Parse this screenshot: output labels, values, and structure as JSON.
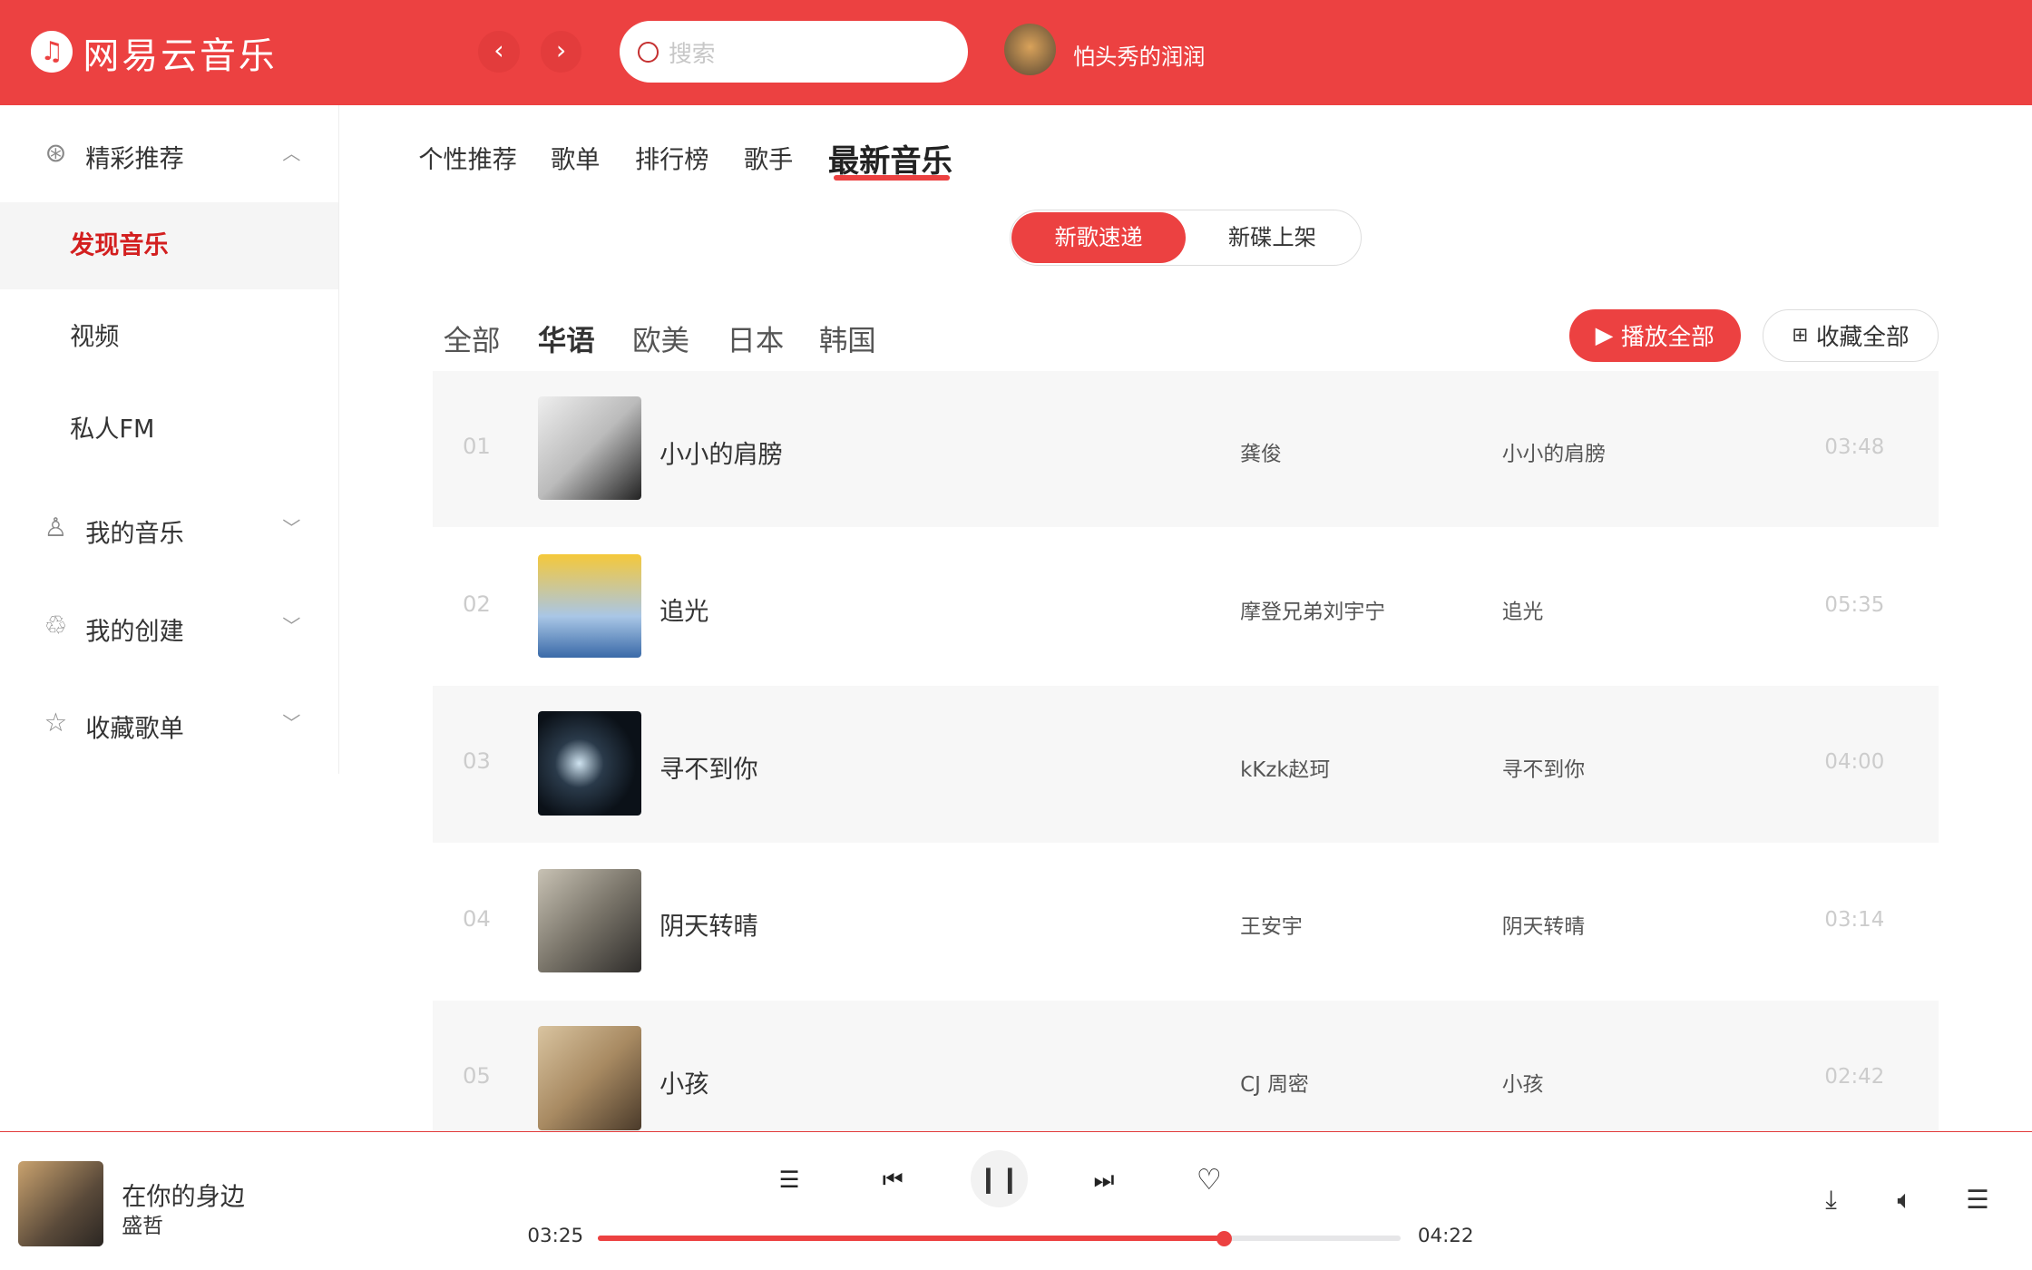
{
  "header": {
    "logo": "网易云音乐",
    "back": "‹",
    "forward": "›",
    "search_placeholder": "搜索",
    "username": "怕头秀的润润"
  },
  "sidebar": {
    "sections": [
      {
        "label": "精彩推荐"
      },
      {
        "label": "我的音乐"
      },
      {
        "label": "我的创建"
      },
      {
        "label": "收藏歌单"
      }
    ],
    "sub_items": [
      {
        "label": "发现音乐",
        "active": true
      },
      {
        "label": "视频"
      },
      {
        "label": "私人FM"
      }
    ]
  },
  "tabs": [
    {
      "label": "个性推荐"
    },
    {
      "label": "歌单"
    },
    {
      "label": "排行榜"
    },
    {
      "label": "歌手"
    },
    {
      "label": "最新音乐",
      "active": true
    }
  ],
  "toggle": {
    "active": "新歌速递",
    "inactive": "新碟上架"
  },
  "filters": [
    {
      "label": "全部"
    },
    {
      "label": "华语",
      "active": true
    },
    {
      "label": "欧美"
    },
    {
      "label": "日本"
    },
    {
      "label": "韩国"
    }
  ],
  "actions": {
    "play_all": "播放全部",
    "collect_all": "收藏全部"
  },
  "songs": [
    {
      "num": "01",
      "title": "小小的肩膀",
      "artist": "龚俊",
      "album": "小小的肩膀",
      "duration": "03:48"
    },
    {
      "num": "02",
      "title": "追光",
      "artist": "摩登兄弟刘宇宁",
      "album": "追光",
      "duration": "05:35"
    },
    {
      "num": "03",
      "title": "寻不到你",
      "artist": "kKzk赵珂",
      "album": "寻不到你",
      "duration": "04:00"
    },
    {
      "num": "04",
      "title": "阴天转晴",
      "artist": "王安宇",
      "album": "阴天转晴",
      "duration": "03:14"
    },
    {
      "num": "05",
      "title": "小孩",
      "artist": "CJ 周密",
      "album": "小孩",
      "duration": "02:42"
    }
  ],
  "player": {
    "title": "在你的身边",
    "artist": "盛哲",
    "current": "03:25",
    "total": "04:22",
    "progress": 0.78
  },
  "colors": {
    "brand": "#ec4141"
  }
}
